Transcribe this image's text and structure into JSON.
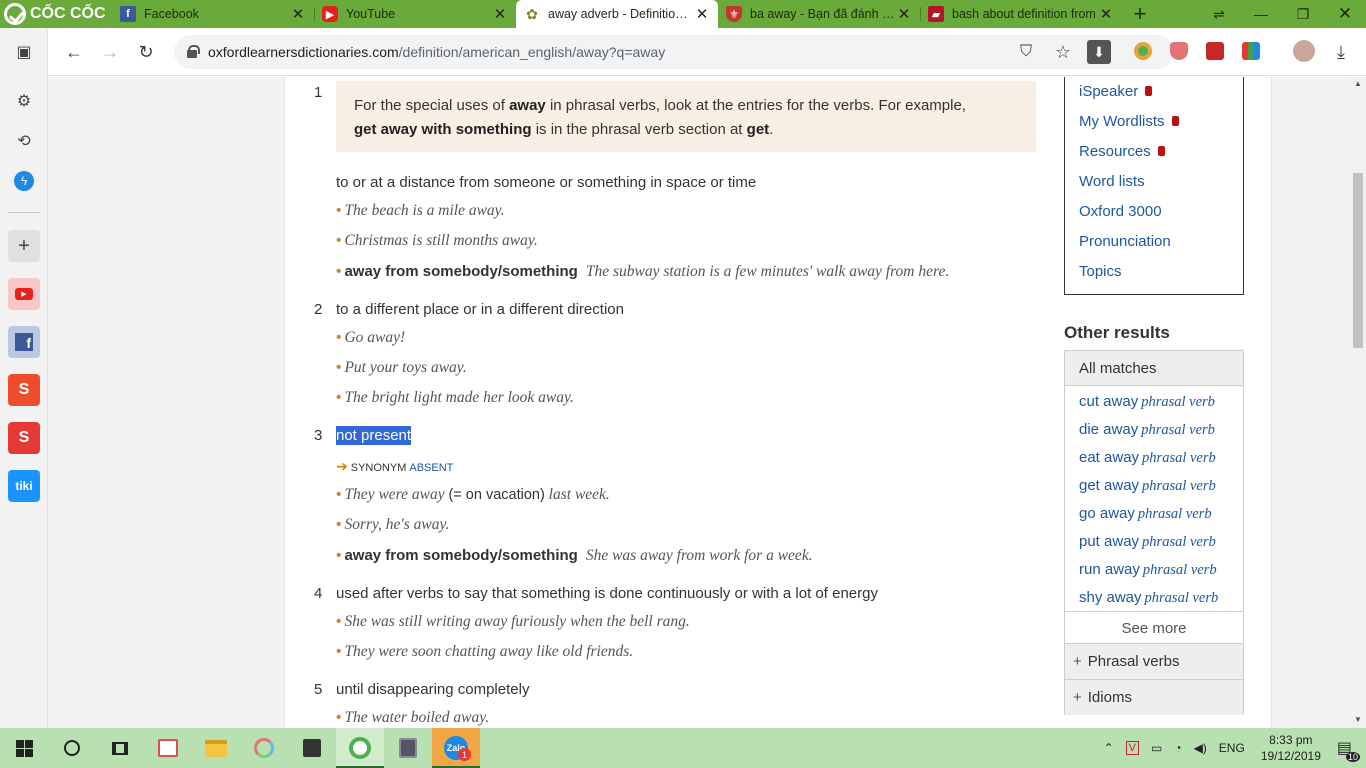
{
  "browser": {
    "brand": "CỐC CỐC",
    "tabs": [
      {
        "title": "Facebook",
        "close": "✕",
        "icon": "facebook-icon",
        "color": "#3b5998"
      },
      {
        "title": "YouTube",
        "close": "✕",
        "icon": "youtube-icon",
        "color": "#e62117"
      },
      {
        "title": "away adverb - Definition, pictures, pronunciation",
        "close": "✕",
        "icon": "oxford-icon",
        "color": "#6b8e23"
      },
      {
        "title": "ba away - Bạn đã đánh văn bản",
        "close": "✕",
        "icon": "cambridge-icon",
        "color": "#c0392b"
      },
      {
        "title": "bash about definition from",
        "close": "✕",
        "icon": "book-icon",
        "color": "#b5142b"
      }
    ],
    "new_tab": "+",
    "url_host": "oxfordlearnersdictionaries.com",
    "url_path": "/definition/american_english/away?q=away"
  },
  "entry": {
    "note": {
      "part1": "For the special uses of ",
      "bold1": "away",
      "part2": " in phrasal verbs, look at the entries for the verbs. For example,",
      "bold2": "get away with something",
      "part3": " is in the phrasal verb section at ",
      "bold3": "get",
      "part4": "."
    },
    "senses": [
      {
        "num": "1",
        "def": "to or at a distance from someone or something in space or time",
        "examples": [
          "The beach is a mile away.",
          "Christmas is still months away."
        ],
        "collocation": {
          "cf": "away from somebody/something",
          "ex": "The subway station is a few minutes' walk away from here."
        }
      },
      {
        "num": "2",
        "def": "to a different place or in a different direction",
        "examples": [
          "Go away!",
          "Put your toys away.",
          "The bright light made her look away."
        ]
      },
      {
        "num": "3",
        "def": "not present",
        "synonym_label": "SYNONYM",
        "synonym": "ABSENT",
        "example_gloss": {
          "a": "They were away ",
          "b": "(= on vacation)",
          "c": " last week."
        },
        "examples": [
          "Sorry, he's away."
        ],
        "collocation": {
          "cf": "away from somebody/something",
          "ex": "She was away from work for a week."
        }
      },
      {
        "num": "4",
        "def": "used after verbs to say that something is done continuously or with a lot of energy",
        "examples": [
          "She was still writing away furiously when the bell rang.",
          "They were soon chatting away like old friends."
        ]
      },
      {
        "num": "5",
        "def": "until disappearing completely",
        "examples": [
          "The water boiled away."
        ]
      }
    ]
  },
  "sidebar_links": [
    "iSpeaker",
    "My Wordlists",
    "Resources",
    "Word lists",
    "Oxford 3000",
    "Pronunciation",
    "Topics"
  ],
  "other_results": {
    "title": "Other results",
    "tab": "All matches",
    "matches": [
      {
        "word": "cut away",
        "pos": "phrasal verb"
      },
      {
        "word": "die away",
        "pos": "phrasal verb"
      },
      {
        "word": "eat away",
        "pos": "phrasal verb"
      },
      {
        "word": "get away",
        "pos": "phrasal verb"
      },
      {
        "word": "go away",
        "pos": "phrasal verb"
      },
      {
        "word": "put away",
        "pos": "phrasal verb"
      },
      {
        "word": "run away",
        "pos": "phrasal verb"
      },
      {
        "word": "shy away",
        "pos": "phrasal verb"
      }
    ],
    "see_more": "See more",
    "phrasal_verbs": "Phrasal verbs",
    "idioms": "Idioms"
  },
  "taskbar": {
    "lang": "ENG",
    "time": "8:33 pm",
    "date": "19/12/2019",
    "notif_count": "10",
    "zalo_badge": "1"
  },
  "colors": {
    "brand_green": "#6aaa3b",
    "link_blue": "#1e56a0",
    "selection": "#3367d6",
    "note_bg": "#f8efe4"
  }
}
